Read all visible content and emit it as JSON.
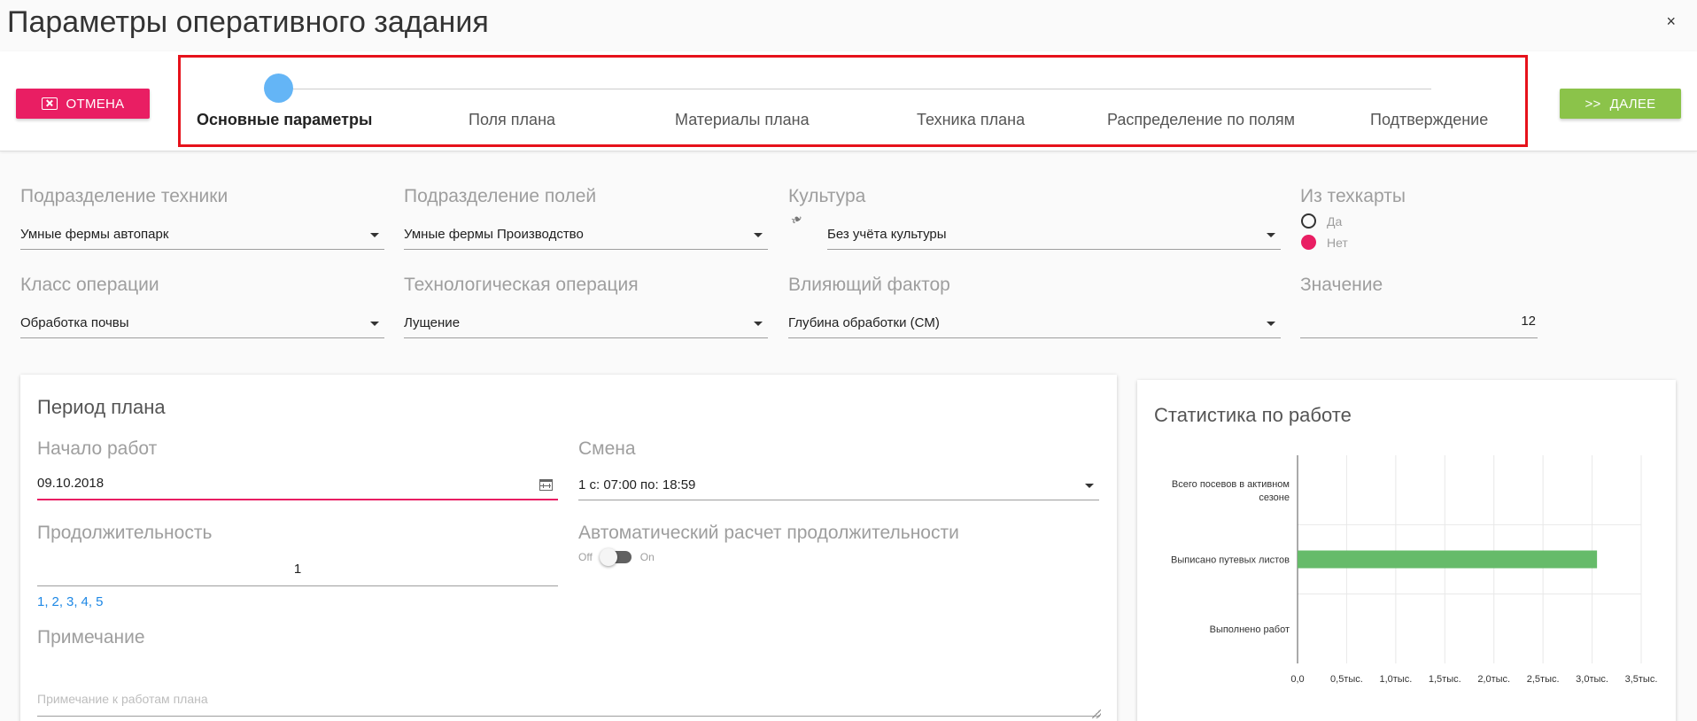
{
  "window": {
    "title": "Параметры оперативного задания",
    "close_glyph": "×"
  },
  "toolbar": {
    "cancel_label": "ОТМЕНА",
    "next_label": "ДАЛЕЕ",
    "next_glyph": ">>"
  },
  "steps": [
    {
      "label": "Основные параметры",
      "active": true
    },
    {
      "label": "Поля плана",
      "active": false
    },
    {
      "label": "Материалы плана",
      "active": false
    },
    {
      "label": "Техника плана",
      "active": false
    },
    {
      "label": "Распределение по полям",
      "active": false
    },
    {
      "label": "Подтверждение",
      "active": false
    }
  ],
  "form": {
    "equipment_division": {
      "label": "Подразделение техники",
      "value": "Умные фермы автопарк"
    },
    "field_division": {
      "label": "Подразделение полей",
      "value": "Умные фермы Производство"
    },
    "crop": {
      "label": "Культура",
      "value": "Без учёта культуры"
    },
    "from_techcard": {
      "label": "Из техкарты",
      "options": [
        "Да",
        "Нет"
      ],
      "selected": "Нет"
    },
    "operation_class": {
      "label": "Класс операции",
      "value": "Обработка почвы"
    },
    "tech_operation": {
      "label": "Технологическая операция",
      "value": "Лущение"
    },
    "factor": {
      "label": "Влияющий фактор",
      "value": "Глубина обработки (СМ)"
    },
    "value": {
      "label": "Значение",
      "value": "12"
    }
  },
  "period": {
    "title": "Период плана",
    "start": {
      "label": "Начало работ",
      "value": "09.10.2018"
    },
    "shift": {
      "label": "Смена",
      "value": "1 с: 07:00 по: 18:59"
    },
    "duration": {
      "label": "Продолжительность",
      "value": "1",
      "quick": [
        "1",
        "2",
        "3",
        "4",
        "5"
      ]
    },
    "auto_calc": {
      "label": "Автоматический расчет продолжительности",
      "off": "Off",
      "on": "On",
      "state": false
    },
    "note": {
      "label": "Примечание",
      "placeholder": "Примечание к работам плана"
    }
  },
  "stats": {
    "title": "Статистика по работе"
  },
  "chart_data": {
    "type": "bar",
    "orientation": "horizontal",
    "categories": [
      "Всего посевов в активном сезоне",
      "Выписано путевых листов",
      "Выполнено работ"
    ],
    "values": [
      0,
      3050,
      0
    ],
    "xlim": [
      0,
      3500
    ],
    "ticks": [
      0,
      500,
      1000,
      1500,
      2000,
      2500,
      3000,
      3500
    ],
    "tick_labels": [
      "0,0",
      "0,5тыс.",
      "1,0тыс.",
      "1,5тыс.",
      "2,0тыс.",
      "2,5тыс.",
      "3,0тыс.",
      "3,5тыс."
    ],
    "bar_color": "#66bb6a",
    "grid": true
  }
}
